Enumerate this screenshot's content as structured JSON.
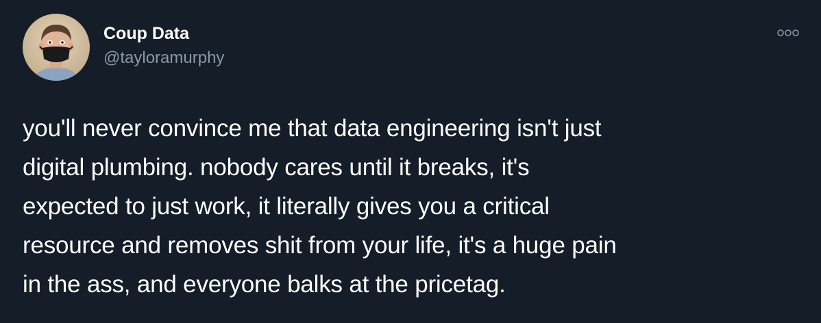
{
  "tweet": {
    "author": {
      "display_name": "Coup Data",
      "handle": "@tayloramurphy",
      "avatar_icon": "profile-photo-masked-person"
    },
    "more_icon": "more-options-icon",
    "text_lines": [
      "you'll never convince me that data engineering isn't just",
      "digital plumbing. nobody cares until it breaks, it's",
      "expected to just work, it literally gives you a critical",
      "resource and removes shit from your life, it's a huge pain",
      "in the ass, and everyone balks at the pricetag."
    ]
  },
  "colors": {
    "background": "#151d29",
    "text_primary": "#ffffff",
    "text_secondary": "#8b98a5"
  }
}
